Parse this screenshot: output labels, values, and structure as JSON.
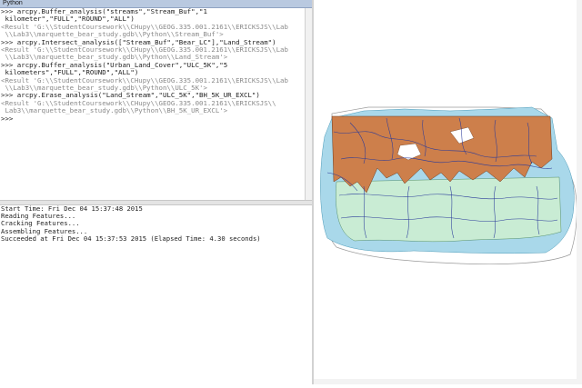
{
  "window": {
    "title": "Python"
  },
  "console": {
    "lines": [
      {
        "kind": "cmd",
        "text": ">>> arcpy.Buffer_analysis(\"streams\",\"Stream_Buf\",\"1"
      },
      {
        "kind": "cmd",
        "text": " kilometer\",\"FULL\",\"ROUND\",\"ALL\")"
      },
      {
        "kind": "res",
        "text": "<Result 'G:\\\\StudentCoursework\\\\CHupy\\\\GEOG.335.001.2161\\\\ERICKSJS\\\\Lab"
      },
      {
        "kind": "res",
        "text": " \\\\Lab3\\\\marquette_bear_study.gdb\\\\Python\\\\Stream_Buf'>"
      },
      {
        "kind": "cmd",
        "text": ">>> arcpy.Intersect_analysis([\"Stream_Buf\",\"Bear_LC\"],\"Land_Stream\")"
      },
      {
        "kind": "res",
        "text": "<Result 'G:\\\\StudentCoursework\\\\CHupy\\\\GEOG.335.001.2161\\\\ERICKSJS\\\\Lab"
      },
      {
        "kind": "res",
        "text": " \\\\Lab3\\\\marquette_bear_study.gdb\\\\Python\\\\Land_Stream'>"
      },
      {
        "kind": "cmd",
        "text": ">>> arcpy.Buffer_analysis(\"Urban_Land_Cover\",\"ULC_5K\",\"5"
      },
      {
        "kind": "cmd",
        "text": " kilometers\",\"FULL\",\"ROUND\",\"ALL\")"
      },
      {
        "kind": "res",
        "text": "<Result 'G:\\\\StudentCoursework\\\\CHupy\\\\GEOG.335.001.2161\\\\ERICKSJS\\\\Lab"
      },
      {
        "kind": "res",
        "text": " \\\\Lab3\\\\marquette_bear_study.gdb\\\\Python\\\\ULC_5K'>"
      },
      {
        "kind": "cmd",
        "text": ">>> arcpy.Erase_analysis(\"Land_Stream\",\"ULC_5K\",\"BH_5K_UR_EXCL\")"
      },
      {
        "kind": "res",
        "text": "<Result 'G:\\\\StudentCoursework\\\\CHupy\\\\GEOG.335.001.2161\\\\ERICKSJS\\\\"
      },
      {
        "kind": "res",
        "text": " Lab3\\\\marquette_bear_study.gdb\\\\Python\\\\BH_5K_UR_EXCL'>"
      },
      {
        "kind": "cmd",
        "text": ">>>"
      }
    ]
  },
  "messages": [
    "Start Time: Fri Dec 04 15:37:48 2015",
    "Reading Features...",
    "Cracking Features...",
    "Assembling Features...",
    "Succeeded at Fri Dec 04 15:37:53 2015 (Elapsed Time: 4.30 seconds)"
  ],
  "map": {
    "colors": {
      "outer_buffer": "#ffffff",
      "stream_buffer": "#a9d8ea",
      "land_cover_green": "#c9ecd4",
      "land_cover_orange": "#cd7f4b",
      "streams": "#2a3a9a",
      "background": "#ffffff"
    }
  }
}
